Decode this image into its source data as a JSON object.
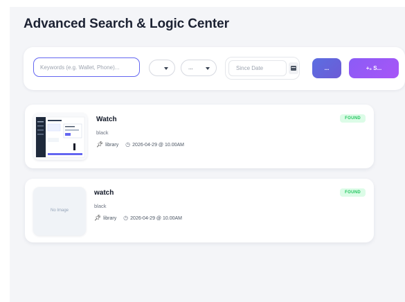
{
  "title": "Advanced Search & Logic Center",
  "search": {
    "keyword_placeholder": "Keywords (e.g. Wallet, Phone)...",
    "keyword_value": "",
    "select1_value": "",
    "select2_value": "...",
    "date_placeholder": "Since Date",
    "more_button_label": "...",
    "search_button_label": "+₀ S..."
  },
  "results": [
    {
      "title": "Watch",
      "color": "black",
      "location": "library",
      "datetime": "2026-04-29 @ 10.00AM",
      "status": "FOUND",
      "has_image": true,
      "placeholder_text": ""
    },
    {
      "title": "watch",
      "color": "black",
      "location": "library",
      "datetime": "2026-04-29 @ 10.00AM",
      "status": "FOUND",
      "has_image": false,
      "placeholder_text": "No Image"
    }
  ],
  "colors": {
    "accent": "#6366f1",
    "button_gradient_start": "#5b6ee1",
    "button_purple": "#a855f7",
    "found_badge_bg": "#dcfce7",
    "found_badge_text": "#22c55e",
    "page_bg": "#f4f5f8"
  },
  "icons": {
    "location": "pin-icon",
    "time": "clock-icon",
    "calendar": "calendar-icon",
    "dropdown": "chevron-down-icon",
    "search_button": "sparkle-icon"
  }
}
